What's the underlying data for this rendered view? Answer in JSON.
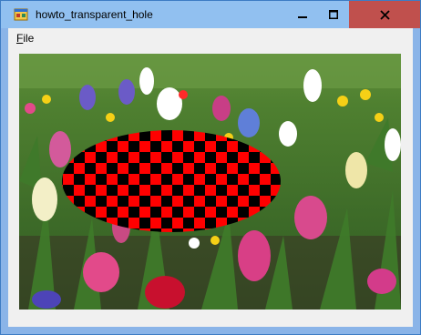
{
  "window": {
    "title": "howto_transparent_hole",
    "icon": "form-app-icon",
    "controls": {
      "minimize": "minimize-icon",
      "maximize": "maximize-icon",
      "close": "close-icon"
    }
  },
  "menubar": {
    "items": [
      {
        "label": "File",
        "mnemonic": "F",
        "rest": "ile"
      }
    ]
  },
  "picture": {
    "description_icon": "flower-photo",
    "hole_pattern": "checkerboard",
    "colors": {
      "checker_a": "#ff0000",
      "checker_b": "#000000",
      "accent": "#c0504d"
    }
  }
}
